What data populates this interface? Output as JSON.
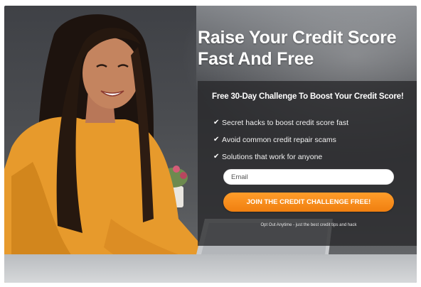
{
  "headline": {
    "line1": "Raise Your Credit Score",
    "line2": "Fast And Free"
  },
  "panel": {
    "title": "Free 30-Day Challenge To Boost Your Credit Score!",
    "bullets": [
      {
        "check": "✔",
        "text": "Secret hacks to boost credit score fast"
      },
      {
        "check": "✔",
        "text": "Avoid common credit repair scams"
      },
      {
        "check": "✔",
        "text": "Solutions that work for anyone"
      }
    ],
    "email_placeholder": "Email",
    "cta_label": "JOIN THE CREDIT CHALLENGE FREE!",
    "fineprint": "Opt Out Anytime - just the best credit tips and hack"
  },
  "colors": {
    "accent_orange": "#f4891c",
    "panel_bg": "#28282a",
    "sweater": "#e79a2c"
  },
  "icons": [
    "checkmark-icon"
  ]
}
